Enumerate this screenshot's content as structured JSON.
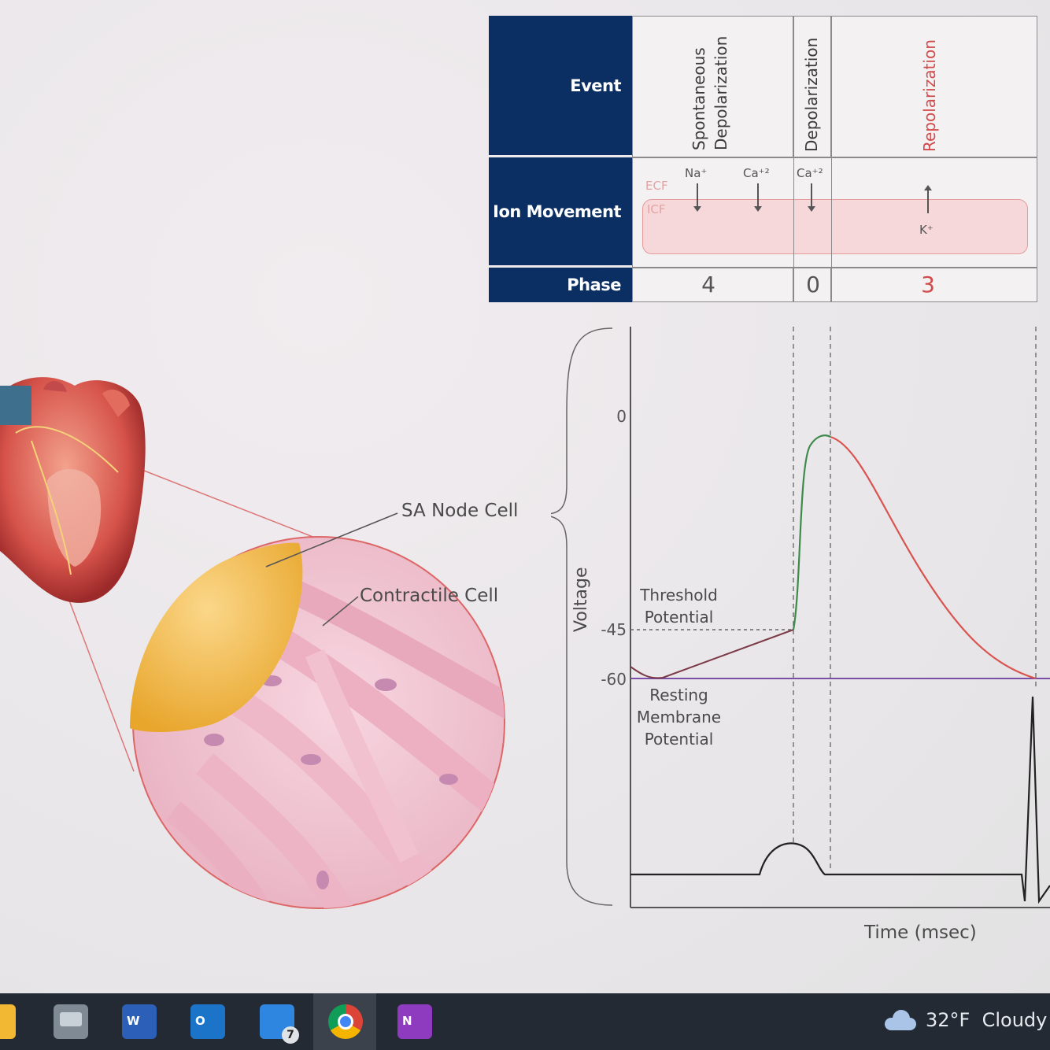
{
  "table": {
    "row_headers": {
      "event": "Event",
      "ion_movement": "Ion Movement",
      "phase": "Phase"
    },
    "events": {
      "spontaneous_line1": "Spontaneous",
      "spontaneous_line2": "Depolarization",
      "depolarization": "Depolarization",
      "repolarization": "Repolarization"
    },
    "ions": {
      "ecf": "ECF",
      "icf": "ICF",
      "na": "Na⁺",
      "ca1": "Ca⁺²",
      "ca2": "Ca⁺²",
      "k": "K⁺"
    },
    "phases": {
      "p4": "4",
      "p0": "0",
      "p3": "3"
    }
  },
  "illustration": {
    "sa_node_label": "SA Node Cell",
    "contractile_label": "Contractile Cell"
  },
  "graph": {
    "y_axis_label": "Voltage",
    "x_axis_label": "Time (msec)",
    "ticks": {
      "zero": "0",
      "m45": "-45",
      "m60": "-60"
    },
    "threshold_line1": "Threshold",
    "threshold_line2": "Potential",
    "resting_line1": "Resting",
    "resting_line2": "Membrane",
    "resting_line3": "Potential",
    "colors": {
      "depolarization": "#3d8a4b",
      "repolarization": "#d9534f",
      "spontaneous": "#7b3b48",
      "resting_line": "#7a4fa8"
    }
  },
  "taskbar": {
    "apps": [
      "file-explorer-icon",
      "network-drive-icon",
      "word-icon",
      "outlook-icon",
      "teams-icon",
      "chrome-icon",
      "onenote-icon"
    ],
    "word_letter": "W",
    "outlook_letter": "O",
    "onenote_letter": "N",
    "teams_badge": "7",
    "weather": "32°F  Cloudy"
  }
}
